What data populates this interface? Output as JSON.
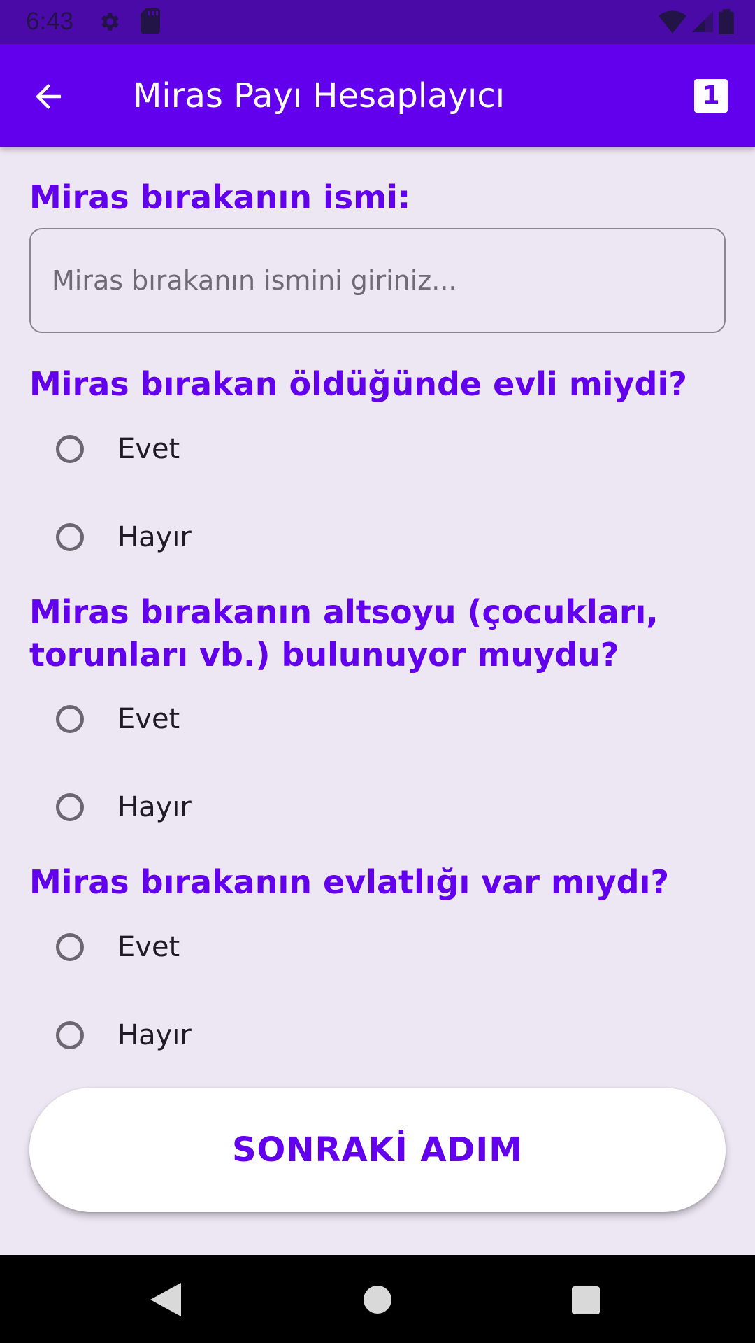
{
  "status_bar": {
    "time": "6:43",
    "icons": [
      "gear-icon",
      "sd-card-icon",
      "wifi-icon",
      "signal-icon",
      "battery-icon"
    ]
  },
  "app_bar": {
    "title": "Miras Payı Hesaplayıcı",
    "back_icon": "arrow-back-icon",
    "badge": "1",
    "background_color": "#6200ee"
  },
  "form": {
    "name_question": "Miras bırakanın ismi:",
    "name_input": {
      "value": "",
      "placeholder": "Miras bırakanın ismini giriniz..."
    },
    "questions": [
      {
        "label": "Miras bırakan öldüğünde evli miydi?",
        "options": [
          "Evet",
          "Hayır"
        ],
        "selected": null
      },
      {
        "label": "Miras bırakanın altsoyu (çocukları, torunları vb.) bulunuyor muydu?",
        "options": [
          "Evet",
          "Hayır"
        ],
        "selected": null
      },
      {
        "label": "Miras bırakanın evlatlığı var mıydı?",
        "options": [
          "Evet",
          "Hayır"
        ],
        "selected": null
      }
    ],
    "next_button": "SONRAKİ ADIM"
  },
  "nav_bar": {
    "icons": [
      "nav-back-icon",
      "nav-home-icon",
      "nav-recents-icon"
    ]
  },
  "colors": {
    "accent": "#6200ee",
    "status_bar": "#4a0aa8",
    "background": "#ede7f3"
  }
}
